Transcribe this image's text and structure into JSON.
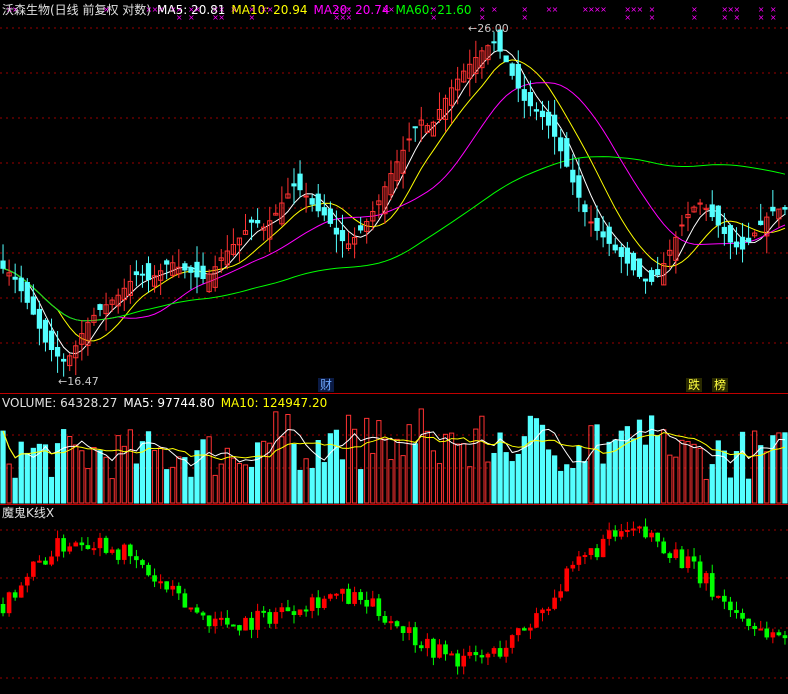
{
  "main_header": {
    "stock_name": "沃森生物(日线 前复权 对数)",
    "ma5": "MA5: 20.81",
    "ma10": "MA10: 20.94",
    "ma20": "MA20: 20.74",
    "ma60": "MA60: 21.60"
  },
  "volume_header": {
    "volume": "VOLUME: 64328.27",
    "ma5": "MA5: 97744.80",
    "ma10": "MA10: 124947.20"
  },
  "indicator_header": {
    "name": "魔鬼K线X"
  },
  "annotations": {
    "high_label": "26.00",
    "low_label": "16.47",
    "tag_cai": "财",
    "tag_die": "跌",
    "tag_bang": "榜"
  },
  "colors": {
    "up": "#ff3232",
    "down": "#54ffff",
    "ind_up": "#ff0000",
    "ind_down": "#00ff00",
    "ma5": "#ffffff",
    "ma10": "#ffff00",
    "ma20": "#ff00ff",
    "ma60": "#00ff00",
    "grid": "#9a0000",
    "marker": "#ff00ff"
  },
  "chart_data": [
    {
      "type": "candlestick",
      "title": "沃森生物(日线 前复权 对数)",
      "y_scale": "log",
      "period": "daily",
      "ylim": [
        16.2,
        26.6
      ],
      "high": 26.0,
      "low": 16.47,
      "close_points": [
        19.0,
        18.8,
        18.3,
        17.8,
        17.2,
        16.9,
        16.7,
        17.1,
        17.6,
        17.9,
        18.1,
        18.3,
        18.6,
        18.9,
        18.7,
        18.9,
        19.2,
        19.0,
        18.9,
        18.7,
        18.9,
        19.3,
        19.6,
        19.9,
        20.3,
        20.1,
        20.4,
        20.9,
        21.3,
        21.0,
        20.6,
        20.4,
        19.9,
        19.6,
        19.9,
        20.3,
        20.8,
        21.5,
        22.1,
        22.7,
        23.3,
        23.0,
        23.7,
        24.3,
        24.8,
        25.2,
        25.6,
        25.9,
        25.4,
        24.6,
        23.9,
        23.6,
        23.3,
        22.7,
        21.9,
        21.1,
        20.4,
        20.0,
        19.7,
        19.4,
        19.1,
        18.8,
        18.6,
        18.9,
        19.5,
        20.1,
        20.6,
        20.8,
        20.4,
        20.0,
        19.6,
        19.5,
        19.9,
        20.3,
        20.6,
        20.6
      ],
      "series": [
        {
          "name": "MA5",
          "last": 20.81
        },
        {
          "name": "MA10",
          "last": 20.94
        },
        {
          "name": "MA20",
          "last": 20.74
        },
        {
          "name": "MA60",
          "last": 21.6
        }
      ]
    },
    {
      "type": "bar",
      "title": "VOLUME",
      "series": [
        {
          "name": "VOLUME",
          "last": 64328.27
        },
        {
          "name": "MA5",
          "last": 97744.8
        },
        {
          "name": "MA10",
          "last": 124947.2
        }
      ]
    },
    {
      "type": "candlestick",
      "title": "魔鬼K线X"
    }
  ]
}
